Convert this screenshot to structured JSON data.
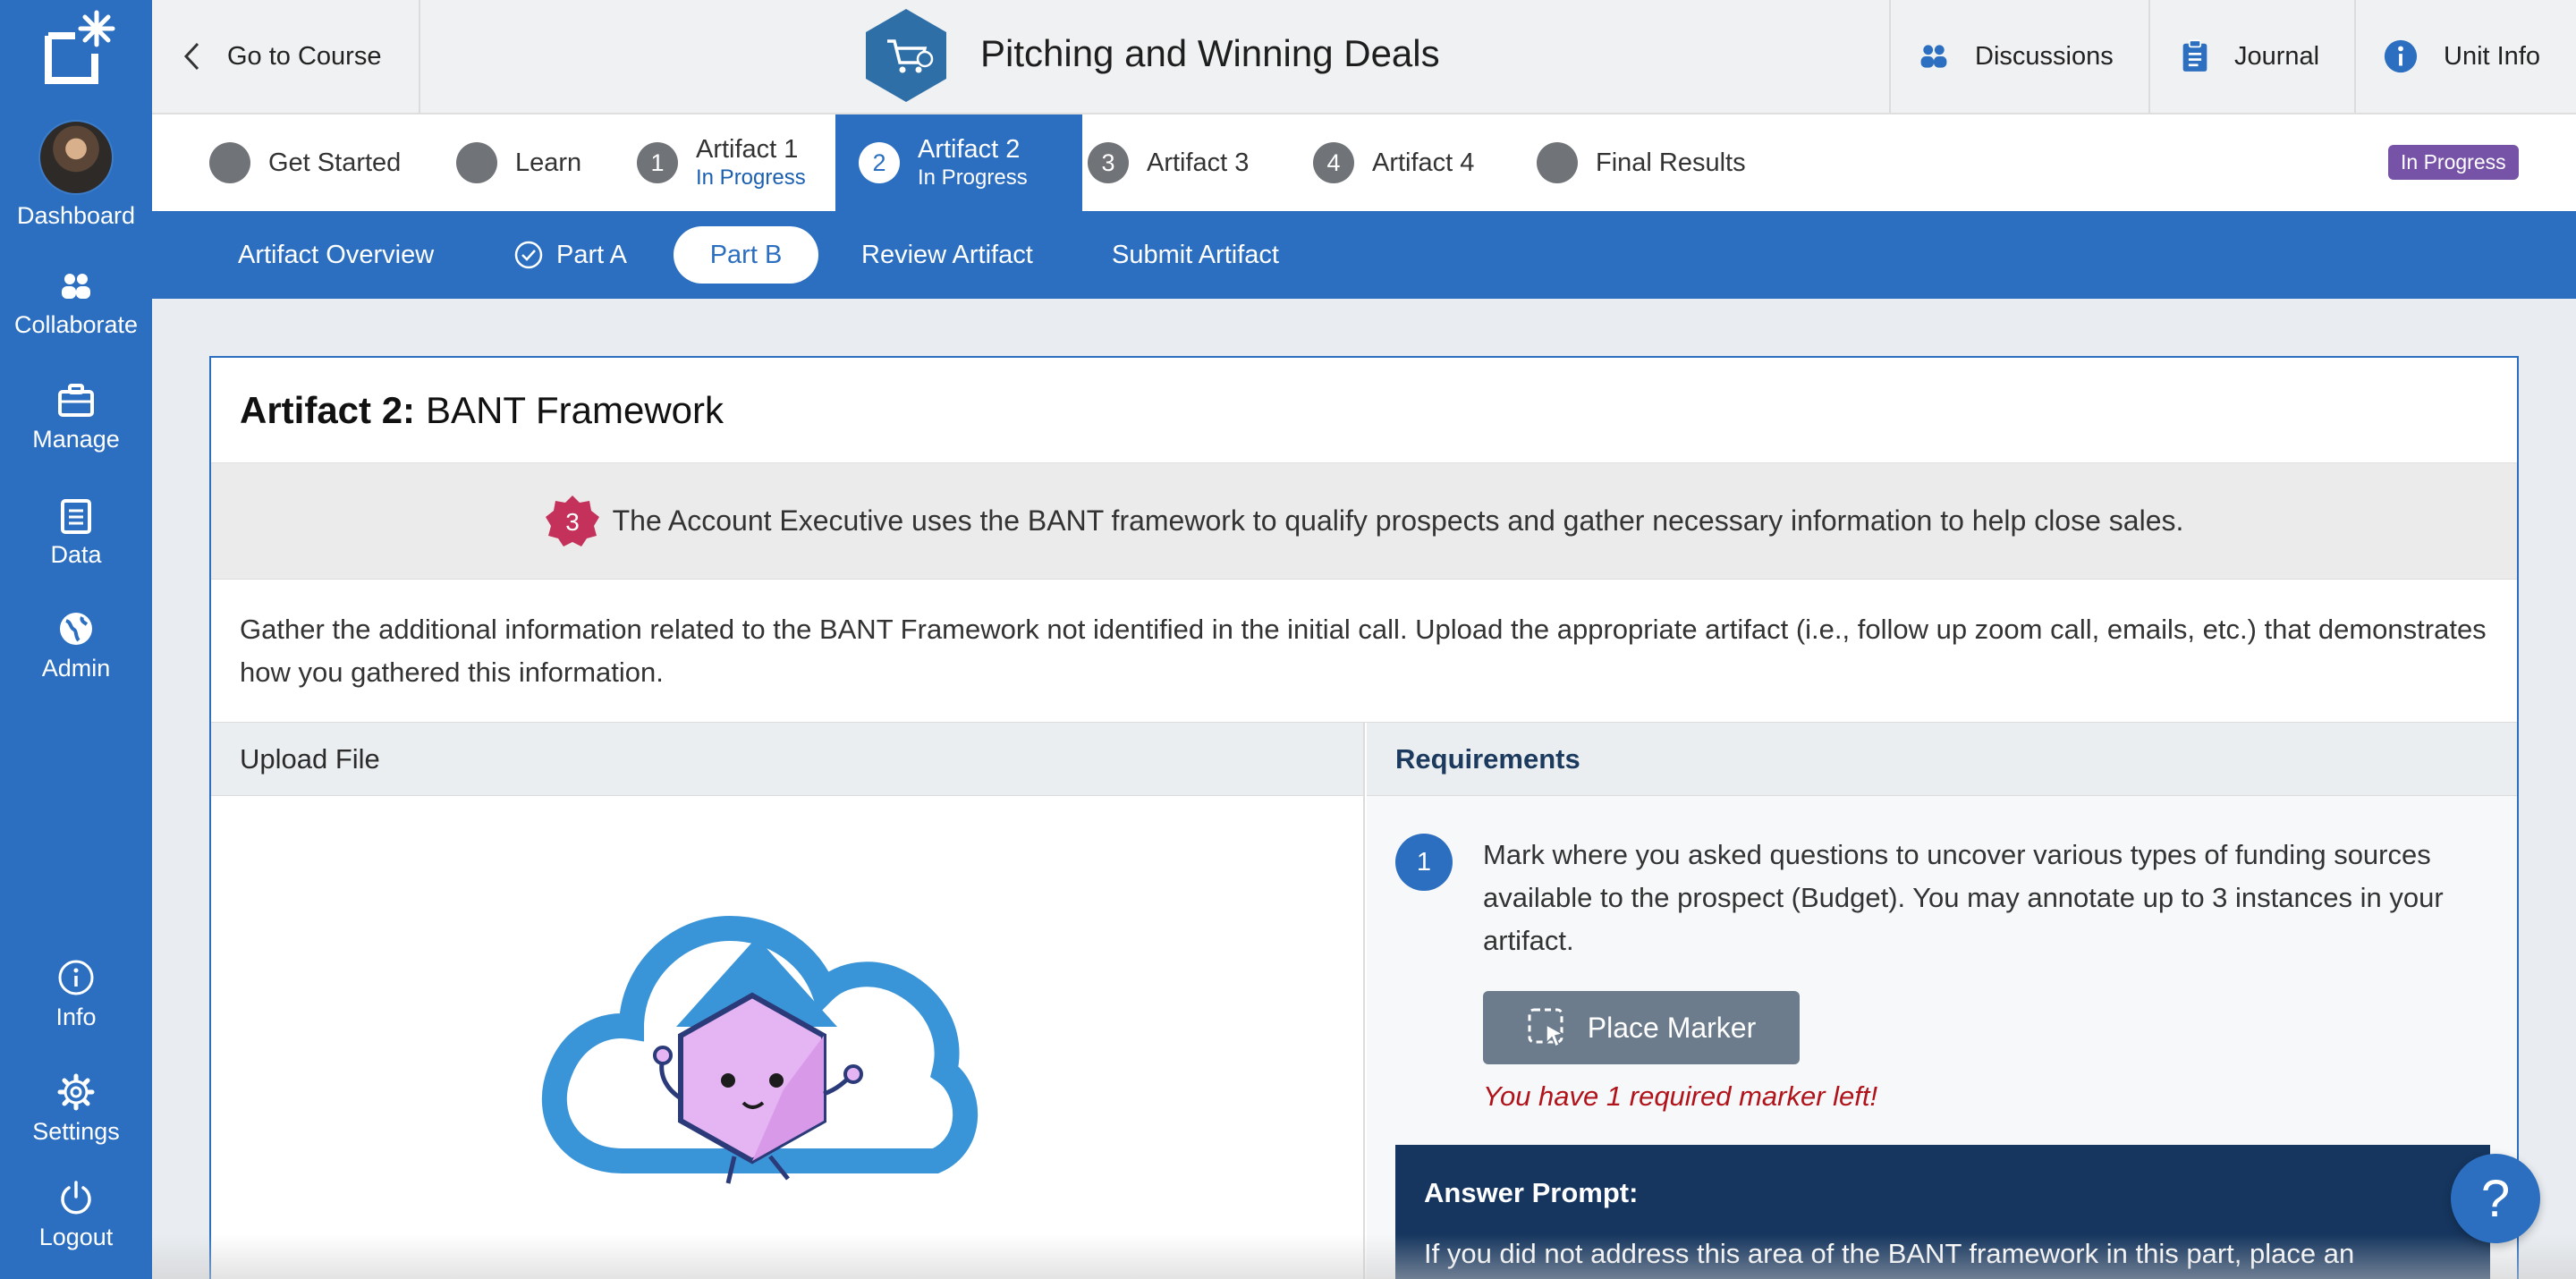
{
  "sidebar": {
    "items": [
      {
        "label": "Dashboard",
        "icon": "avatar"
      },
      {
        "label": "Collaborate",
        "icon": "people-icon"
      },
      {
        "label": "Manage",
        "icon": "briefcase-icon"
      },
      {
        "label": "Data",
        "icon": "clipboard-icon"
      },
      {
        "label": "Admin",
        "icon": "globe-icon"
      },
      {
        "label": "Info",
        "icon": "info-icon"
      },
      {
        "label": "Settings",
        "icon": "gear-icon"
      },
      {
        "label": "Logout",
        "icon": "power-icon"
      }
    ]
  },
  "topbar": {
    "back_label": "Go to Course",
    "course_title": "Pitching and Winning Deals",
    "discussions": "Discussions",
    "journal": "Journal",
    "unit_info": "Unit Info"
  },
  "steps": [
    {
      "num": "",
      "label": "Get Started",
      "sub": ""
    },
    {
      "num": "",
      "label": "Learn",
      "sub": ""
    },
    {
      "num": "1",
      "label": "Artifact 1",
      "sub": "In Progress"
    },
    {
      "num": "2",
      "label": "Artifact 2",
      "sub": "In Progress"
    },
    {
      "num": "3",
      "label": "Artifact 3",
      "sub": ""
    },
    {
      "num": "4",
      "label": "Artifact 4",
      "sub": ""
    },
    {
      "num": "",
      "label": "Final Results",
      "sub": ""
    }
  ],
  "status_pill": "In Progress",
  "subnav": {
    "overview": "Artifact Overview",
    "part_a": "Part A",
    "part_b": "Part B",
    "review": "Review Artifact",
    "submit": "Submit Artifact"
  },
  "card": {
    "title_prefix": "Artifact 2:",
    "title": "BANT Framework",
    "outcome_num": "3",
    "outcome_text": "The Account Executive uses the BANT framework to qualify prospects and gather necessary information to help close sales.",
    "instructions": "Gather the additional information related to the BANT Framework not identified in the initial call. Upload the appropriate artifact (i.e., follow up zoom call, emails, etc.) that demonstrates how you gathered this information.",
    "upload_header": "Upload File",
    "requirements_header": "Requirements",
    "req_num": "1",
    "req_text": "Mark where you asked questions to uncover various types of funding sources available to the prospect (Budget). You may annotate up to 3 instances in your artifact.",
    "place_marker": "Place Marker",
    "marker_warning": "You have 1 required marker left!",
    "answer_title": "Answer Prompt:",
    "answer_text": "If you did not address this area of the BANT framework in this part, place an annotation in the video/ item that says Addressed in Part A."
  },
  "help_label": "?",
  "colors": {
    "primary": "#2c6fc0",
    "status_purple": "#7753a8",
    "warning_red": "#b0141a",
    "answer_navy": "#16365f",
    "outcome_badge": "#c4315a"
  }
}
